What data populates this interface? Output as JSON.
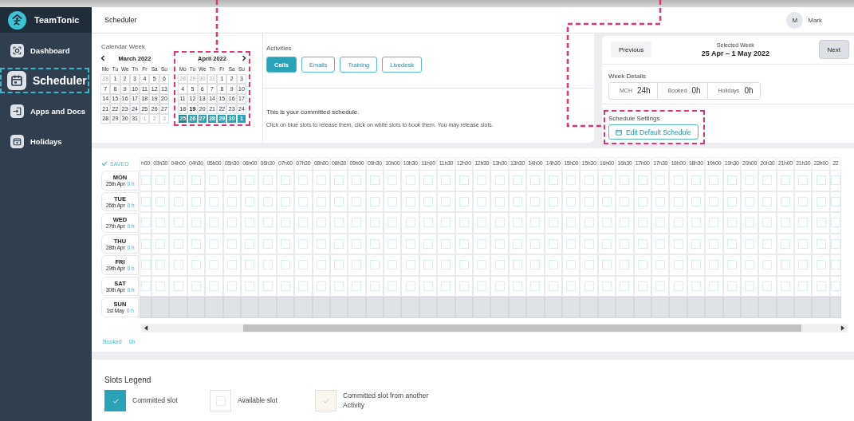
{
  "sidebar": {
    "brand": "TeamTonic",
    "items": [
      {
        "label": "Dashboard",
        "selected": false,
        "highlighted": false
      },
      {
        "label": "Scheduler",
        "selected": true,
        "highlighted": true
      },
      {
        "label": "Apps and Docs",
        "selected": false,
        "highlighted": false
      },
      {
        "label": "Holidays",
        "selected": false,
        "highlighted": false
      }
    ]
  },
  "header": {
    "title": "Scheduler",
    "user": {
      "initial": "M",
      "name": "Mark"
    }
  },
  "calendar": {
    "title": "Calendar Week",
    "months": [
      {
        "title": "March 2022",
        "highlighted": false,
        "weekdays": [
          "Mo",
          "Tu",
          "We",
          "Th",
          "Fr",
          "Sa",
          "Su"
        ],
        "weeks": [
          {
            "selected": false,
            "days": [
              {
                "label": "28",
                "kind": "other"
              },
              {
                "label": "1",
                "kind": "day"
              },
              {
                "label": "2",
                "kind": "day"
              },
              {
                "label": "3",
                "kind": "day"
              },
              {
                "label": "4",
                "kind": "day"
              },
              {
                "label": "5",
                "kind": "day"
              },
              {
                "label": "6",
                "kind": "day"
              }
            ]
          },
          {
            "selected": false,
            "days": [
              {
                "label": "7",
                "kind": "day"
              },
              {
                "label": "8",
                "kind": "day"
              },
              {
                "label": "9",
                "kind": "day"
              },
              {
                "label": "10",
                "kind": "day"
              },
              {
                "label": "11",
                "kind": "day"
              },
              {
                "label": "12",
                "kind": "day"
              },
              {
                "label": "13",
                "kind": "day"
              }
            ]
          },
          {
            "selected": false,
            "days": [
              {
                "label": "14",
                "kind": "day"
              },
              {
                "label": "15",
                "kind": "day"
              },
              {
                "label": "16",
                "kind": "day"
              },
              {
                "label": "17",
                "kind": "day"
              },
              {
                "label": "18",
                "kind": "day"
              },
              {
                "label": "19",
                "kind": "day"
              },
              {
                "label": "20",
                "kind": "day"
              }
            ]
          },
          {
            "selected": false,
            "days": [
              {
                "label": "21",
                "kind": "day"
              },
              {
                "label": "22",
                "kind": "day"
              },
              {
                "label": "23",
                "kind": "day"
              },
              {
                "label": "24",
                "kind": "day"
              },
              {
                "label": "25",
                "kind": "day"
              },
              {
                "label": "26",
                "kind": "day"
              },
              {
                "label": "27",
                "kind": "day"
              }
            ]
          },
          {
            "selected": false,
            "days": [
              {
                "label": "28",
                "kind": "day"
              },
              {
                "label": "29",
                "kind": "day"
              },
              {
                "label": "30",
                "kind": "day"
              },
              {
                "label": "31",
                "kind": "day"
              },
              {
                "label": "1",
                "kind": "other"
              },
              {
                "label": "2",
                "kind": "other"
              },
              {
                "label": "3",
                "kind": "other"
              }
            ]
          }
        ]
      },
      {
        "title": "April 2022",
        "highlighted": true,
        "weekdays": [
          "Mo",
          "Tu",
          "We",
          "Th",
          "Fr",
          "Sa",
          "Su"
        ],
        "weeks": [
          {
            "selected": false,
            "days": [
              {
                "label": "28",
                "kind": "other"
              },
              {
                "label": "29",
                "kind": "other"
              },
              {
                "label": "30",
                "kind": "other"
              },
              {
                "label": "31",
                "kind": "other"
              },
              {
                "label": "1",
                "kind": "day"
              },
              {
                "label": "2",
                "kind": "day"
              },
              {
                "label": "3",
                "kind": "day"
              }
            ]
          },
          {
            "selected": false,
            "days": [
              {
                "label": "4",
                "kind": "day"
              },
              {
                "label": "5",
                "kind": "day"
              },
              {
                "label": "6",
                "kind": "day"
              },
              {
                "label": "7",
                "kind": "day"
              },
              {
                "label": "8",
                "kind": "day"
              },
              {
                "label": "9",
                "kind": "day"
              },
              {
                "label": "10",
                "kind": "day"
              }
            ]
          },
          {
            "selected": false,
            "days": [
              {
                "label": "11",
                "kind": "day"
              },
              {
                "label": "12",
                "kind": "day"
              },
              {
                "label": "13",
                "kind": "day"
              },
              {
                "label": "14",
                "kind": "day"
              },
              {
                "label": "15",
                "kind": "day"
              },
              {
                "label": "16",
                "kind": "day"
              },
              {
                "label": "17",
                "kind": "day"
              }
            ]
          },
          {
            "selected": false,
            "days": [
              {
                "label": "18",
                "kind": "day"
              },
              {
                "label": "19",
                "kind": "today"
              },
              {
                "label": "20",
                "kind": "day"
              },
              {
                "label": "21",
                "kind": "day"
              },
              {
                "label": "22",
                "kind": "day"
              },
              {
                "label": "23",
                "kind": "day"
              },
              {
                "label": "24",
                "kind": "day"
              }
            ]
          },
          {
            "selected": true,
            "days": [
              {
                "label": "25",
                "kind": "anchor"
              },
              {
                "label": "26",
                "kind": "day"
              },
              {
                "label": "27",
                "kind": "day"
              },
              {
                "label": "28",
                "kind": "day"
              },
              {
                "label": "29",
                "kind": "day"
              },
              {
                "label": "30",
                "kind": "day"
              },
              {
                "label": "1",
                "kind": "other"
              }
            ]
          }
        ]
      }
    ]
  },
  "activities": {
    "title": "Activities",
    "tabs": [
      {
        "label": "Calls",
        "selected": true
      },
      {
        "label": "Emails",
        "selected": false
      },
      {
        "label": "Training",
        "selected": false
      },
      {
        "label": "Livedesk",
        "selected": false
      }
    ],
    "message": "This is your committed schedule.",
    "hint": "Click on blue slots to release them, click on white slots to book them. You may release slots."
  },
  "week": {
    "nav": [
      {
        "label": "Previous",
        "pressed": false
      },
      {
        "label": "Next",
        "pressed": true
      }
    ],
    "selected_label": "Selected Week",
    "range": "25 Apr – 1 May 2022",
    "details_title": "Week Details",
    "stats": [
      {
        "label": "MCH",
        "value": "24h"
      },
      {
        "label": "Booked",
        "value": "0h"
      },
      {
        "label": "Holidays",
        "value": "0h"
      }
    ],
    "settings_title": "Schedule Settings",
    "settings_highlighted": true,
    "edit_button": "Edit Default Schedule"
  },
  "grid": {
    "status": "SAVED",
    "hours": [
      "h00",
      "03h30",
      "04h00",
      "04h30",
      "05h00",
      "05h30",
      "06h00",
      "06h30",
      "07h00",
      "07h30",
      "08h00",
      "08h30",
      "09h00",
      "09h30",
      "10h00",
      "10h30",
      "11h00",
      "11h30",
      "12h00",
      "12h30",
      "13h00",
      "13h30",
      "14h00",
      "14h30",
      "15h00",
      "15h30",
      "16h00",
      "16h30",
      "17h00",
      "17h30",
      "18h00",
      "18h30",
      "19h00",
      "19h30",
      "20h00",
      "20h30",
      "21h00",
      "21h30",
      "22h00",
      "22"
    ],
    "days": [
      {
        "name": "MON",
        "date": "25th Apr",
        "hours": "0 h",
        "disabled": false
      },
      {
        "name": "TUE",
        "date": "26th Apr",
        "hours": "0 h",
        "disabled": false
      },
      {
        "name": "WED",
        "date": "27th Apr",
        "hours": "0 h",
        "disabled": false
      },
      {
        "name": "THU",
        "date": "28th Apr",
        "hours": "0 h",
        "disabled": false
      },
      {
        "name": "FRI",
        "date": "29th Apr",
        "hours": "0 h",
        "disabled": false
      },
      {
        "name": "SAT",
        "date": "30th Apr",
        "hours": "0 h",
        "disabled": false
      },
      {
        "name": "SUN",
        "date": "1st May",
        "hours": "0 h",
        "disabled": true
      }
    ],
    "booked_label": "Booked",
    "booked_value": "0h"
  },
  "legend": {
    "title": "Slots Legend",
    "items": [
      {
        "label": "Committed slot",
        "kind": "committed"
      },
      {
        "label": "Available slot",
        "kind": "available"
      },
      {
        "label": "Committed slot from another Activity",
        "kind": "other"
      }
    ]
  }
}
